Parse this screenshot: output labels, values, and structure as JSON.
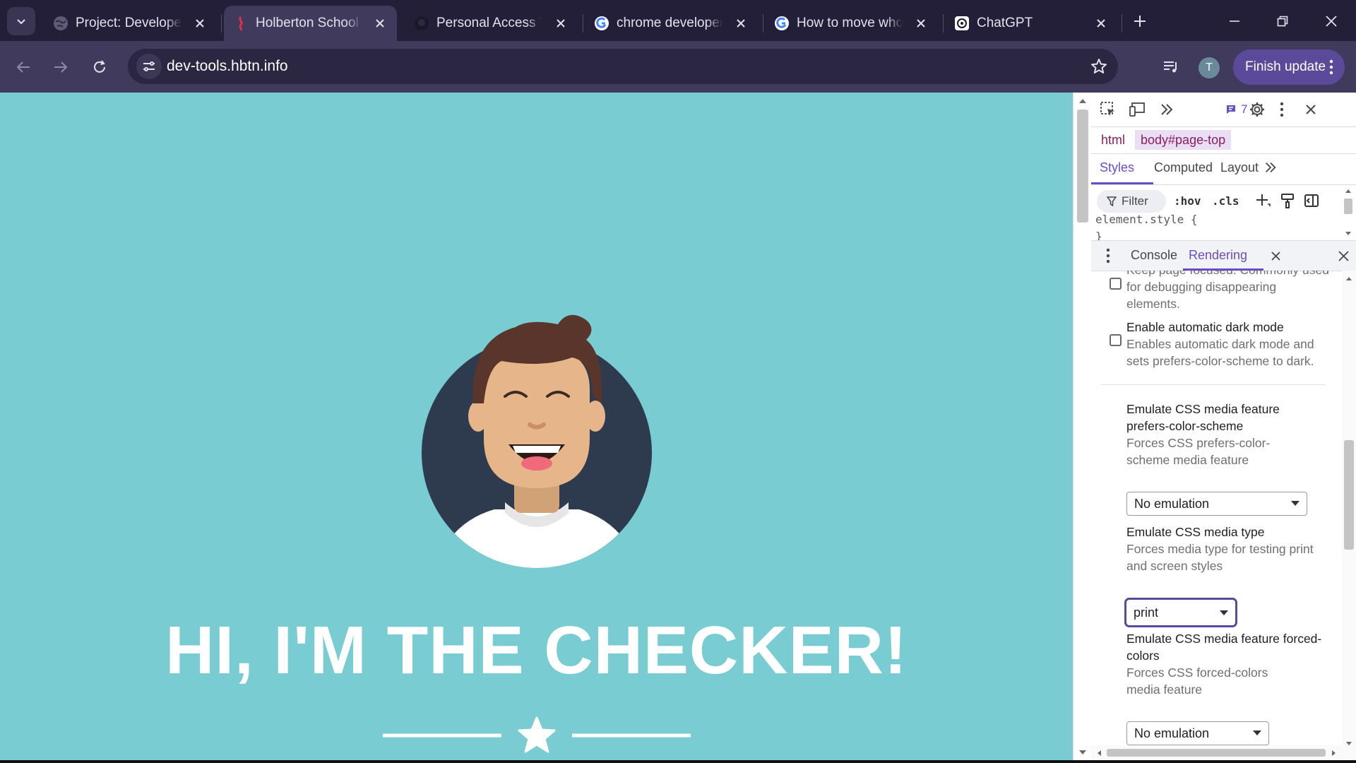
{
  "browser": {
    "tabs": [
      {
        "title": "Project: Developer",
        "icon": "globe-icon",
        "active": false
      },
      {
        "title": "Holberton School",
        "icon": "holberton-icon",
        "active": true
      },
      {
        "title": "Personal Access To",
        "icon": "github-icon",
        "active": false
      },
      {
        "title": "chrome developer",
        "icon": "google-icon",
        "active": false
      },
      {
        "title": "How to move whol",
        "icon": "google-icon",
        "active": false
      },
      {
        "title": "ChatGPT",
        "icon": "chatgpt-icon",
        "active": false
      }
    ],
    "url": "dev-tools.hbtn.info",
    "profile_initial": "T",
    "finish_update": "Finish update"
  },
  "page": {
    "heading": "HI, I'M THE CHECKER!",
    "background_color": "#78ccd2"
  },
  "devtools": {
    "messages_count": "7",
    "breadcrumbs": [
      "html",
      "body#page-top"
    ],
    "subtabs": [
      "Styles",
      "Computed",
      "Layout"
    ],
    "filter_label": "Filter",
    "hov_label": ":hov",
    "cls_label": ".cls",
    "element_style": "element.style {",
    "element_style_close": "}",
    "drawer_tabs": [
      "Console",
      "Rendering"
    ],
    "rendering": {
      "focus_desc": "Keep page focused. Commonly used for debugging disappearing elements.",
      "dark_mode_title": "Enable automatic dark mode",
      "dark_mode_desc": "Enables automatic dark mode and sets prefers-color-scheme to dark.",
      "color_scheme_title": "Emulate CSS media feature prefers-color-scheme",
      "color_scheme_desc": "Forces CSS prefers-color-scheme media feature",
      "color_scheme_value": "No emulation",
      "media_type_title": "Emulate CSS media type",
      "media_type_desc": "Forces media type for testing print and screen styles",
      "media_type_value": "print",
      "forced_colors_title": "Emulate CSS media feature forced-colors",
      "forced_colors_desc": "Forces CSS forced-colors media feature",
      "forced_colors_value": "No emulation"
    }
  }
}
